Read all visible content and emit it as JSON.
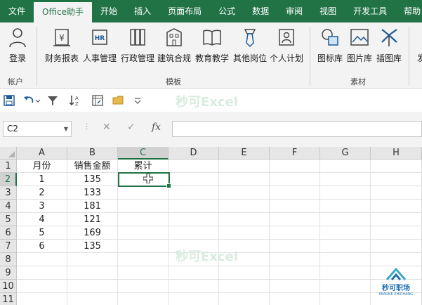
{
  "tabs": [
    "文件",
    "Office助手",
    "开始",
    "插入",
    "页面布局",
    "公式",
    "数据",
    "审阅",
    "视图",
    "开发工具",
    "帮助"
  ],
  "active_tab_index": 1,
  "ribbon": {
    "account_label": "登录",
    "account_group": "帐户",
    "template_items": [
      "财务报表",
      "人事管理",
      "行政管理",
      "建筑合规",
      "教育教学",
      "其他岗位",
      "个人计划"
    ],
    "template_group": "模板",
    "material_items": [
      "图标库",
      "图片库",
      "插图库"
    ],
    "material_group": "素材",
    "overflow_label": "发"
  },
  "watermark": "秒可Excel",
  "name_box": "C2",
  "formula_value": "",
  "columns": [
    "A",
    "B",
    "C",
    "D",
    "E",
    "F",
    "G",
    "H"
  ],
  "rows": [
    "1",
    "2",
    "3",
    "4",
    "5",
    "6",
    "7",
    "8",
    "9",
    "10",
    "11"
  ],
  "table": {
    "headers": [
      "月份",
      "销售金额",
      "累计"
    ],
    "data": [
      [
        "1",
        "135",
        ""
      ],
      [
        "2",
        "133",
        ""
      ],
      [
        "3",
        "181",
        ""
      ],
      [
        "4",
        "121",
        ""
      ],
      [
        "5",
        "169",
        ""
      ],
      [
        "6",
        "135",
        ""
      ]
    ]
  },
  "selected_cell": "C2",
  "logo": {
    "name": "秒可职场",
    "tagline": "MIAOKE ZHICHANG"
  },
  "colors": {
    "accent": "#217346",
    "ribbon": "#f3f3f3"
  }
}
